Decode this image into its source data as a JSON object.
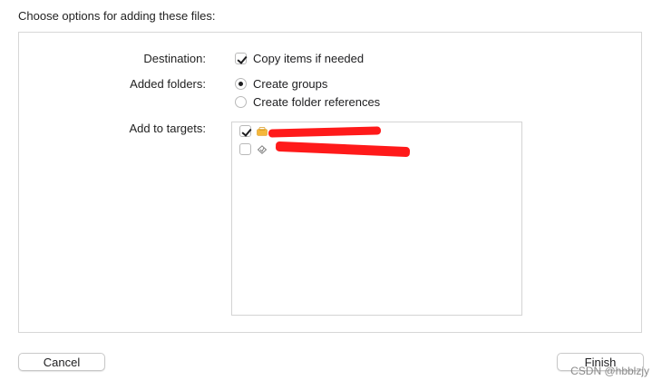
{
  "dialog": {
    "title": "Choose options for adding these files:"
  },
  "destination": {
    "label": "Destination:",
    "copy_items_label": "Copy items if needed",
    "copy_items_checked": true
  },
  "added_folders": {
    "label": "Added folders:",
    "options": [
      {
        "label": "Create groups",
        "selected": true
      },
      {
        "label": "Create folder references",
        "selected": false
      }
    ]
  },
  "targets": {
    "label": "Add to targets:",
    "items": [
      {
        "checked": true,
        "icon": "app-target-icon",
        "name_redacted": true
      },
      {
        "checked": false,
        "icon": "test-target-icon",
        "name_redacted": true
      }
    ]
  },
  "buttons": {
    "cancel_label": "Cancel",
    "finish_label": "Finish"
  },
  "watermark": "CSDN @hbblzjy",
  "colors": {
    "redaction": "#ff1a1a",
    "panel_border": "#d7d7d7"
  }
}
